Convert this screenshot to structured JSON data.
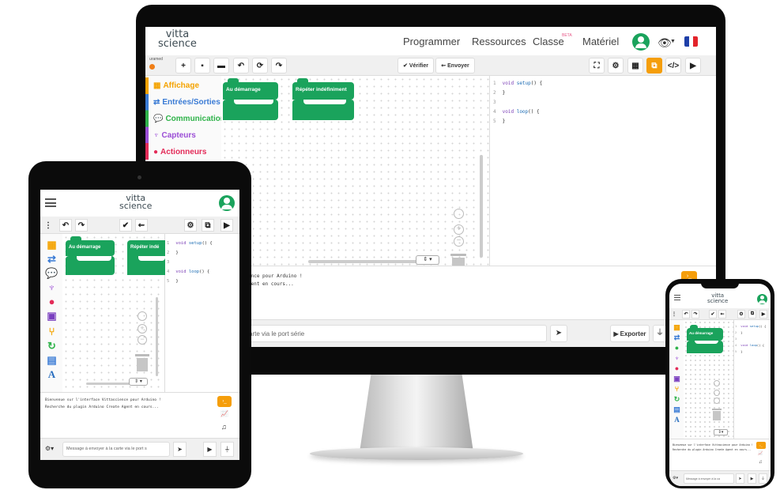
{
  "logo": {
    "line1": "vitta",
    "line2": "science"
  },
  "monitor": {
    "nav": [
      "Programmer",
      "Ressources",
      "Classe",
      "Matériel"
    ],
    "beta_badge": "BETA",
    "board_label": "uramed",
    "toolbar": {
      "verify": "Vérifier",
      "send": "Envoyer"
    },
    "categories": [
      {
        "label": "Affichage",
        "color": "#f4a300"
      },
      {
        "label": "Entrées/Sorties",
        "color": "#3a7bd5"
      },
      {
        "label": "Communication",
        "color": "#2fb34a"
      },
      {
        "label": "Capteurs",
        "color": "#9b4dd6"
      },
      {
        "label": "Actionneurs",
        "color": "#e32b58"
      }
    ],
    "blocks": [
      "Au démarrage",
      "Répéter indéfiniment"
    ],
    "code": [
      {
        "n": "1",
        "kw": "void",
        "fn": "setup",
        "rest": "() {"
      },
      {
        "n": "2",
        "text": "}"
      },
      {
        "n": "3",
        "text": ""
      },
      {
        "n": "4",
        "kw": "void",
        "fn": "loop",
        "rest": "() {"
      },
      {
        "n": "5",
        "text": "}"
      }
    ],
    "console_lines": [
      "ence pour Arduino !",
      "gent en cours..."
    ],
    "serial_placeholder": "carte via le port série",
    "export": "Exporter"
  },
  "tablet": {
    "blocks": [
      "Au démarrage",
      "Répéter indé"
    ],
    "code": [
      {
        "n": "1",
        "kw": "void",
        "fn": "setup",
        "rest": "() {"
      },
      {
        "n": "2",
        "text": "}"
      },
      {
        "n": "3",
        "text": ""
      },
      {
        "n": "4",
        "kw": "void",
        "fn": "loop",
        "rest": "() {"
      },
      {
        "n": "5",
        "text": "}"
      }
    ],
    "console_lines": [
      "Bienvenue sur l'interface Vittascience pour Arduino !",
      "Recherche du plugin Arduino Create Agent en cours..."
    ],
    "serial_placeholder": "Message à envoyer à la carte via le port s"
  },
  "phone": {
    "block": "Au démarrage",
    "code": [
      {
        "n": "1",
        "kw": "void",
        "fn": "setup",
        "rest": "() {"
      },
      {
        "n": "2",
        "text": "}"
      },
      {
        "n": "3",
        "text": ""
      },
      {
        "n": "4",
        "kw": "void",
        "fn": "loop",
        "rest": "() {"
      },
      {
        "n": "5",
        "text": "}"
      }
    ],
    "console_lines": [
      "Bienvenue sur l'interface Vittascience pour Arduino !",
      "Recherche du plugin Arduino Create Agent en cours..."
    ],
    "serial_placeholder": "Message à envoyer à la ca"
  },
  "colors": {
    "accent": "#f59e0b",
    "block_green": "#1aa35c",
    "frame": "#0a0a0a"
  }
}
